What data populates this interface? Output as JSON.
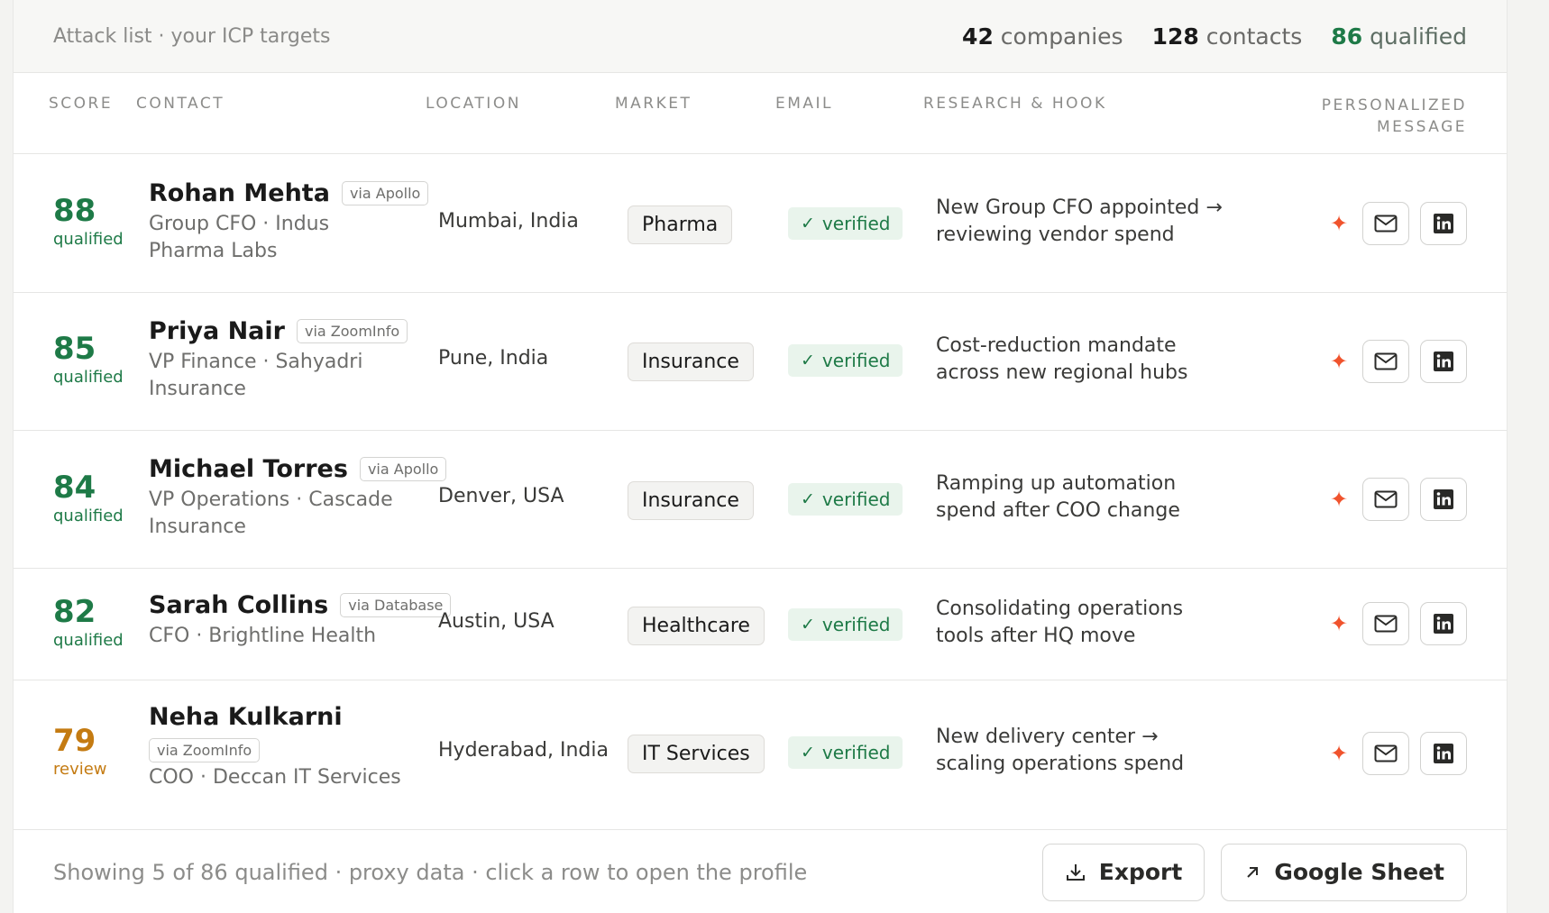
{
  "header": {
    "title": "Attack list · your ICP targets",
    "companies_count": "42",
    "companies_label": "companies",
    "contacts_count": "128",
    "contacts_label": "contacts",
    "qualified_count": "86",
    "qualified_label": "qualified"
  },
  "columns": {
    "score": "SCORE",
    "contact": "CONTACT",
    "location": "LOCATION",
    "market": "MARKET",
    "email": "EMAIL",
    "research": "RESEARCH & HOOK",
    "message_line1": "PERSONALIZED",
    "message_line2": "MESSAGE"
  },
  "rows": [
    {
      "score": "88",
      "status": "qualified",
      "name": "Rohan Mehta",
      "source": "via Apollo",
      "role": "Group CFO · Indus Pharma Labs",
      "location": "Mumbai, India",
      "market": "Pharma",
      "email": "verified",
      "hook": "New Group CFO appointed → reviewing vendor spend"
    },
    {
      "score": "85",
      "status": "qualified",
      "name": "Priya Nair",
      "source": "via ZoomInfo",
      "role": "VP Finance · Sahyadri Insurance",
      "location": "Pune, India",
      "market": "Insurance",
      "email": "verified",
      "hook": "Cost-reduction mandate across new regional hubs"
    },
    {
      "score": "84",
      "status": "qualified",
      "name": "Michael Torres",
      "source": "via Apollo",
      "role": "VP Operations · Cascade Insurance",
      "location": "Denver, USA",
      "market": "Insurance",
      "email": "verified",
      "hook": "Ramping up automation spend after COO change"
    },
    {
      "score": "82",
      "status": "qualified",
      "name": "Sarah Collins",
      "source": "via Database",
      "role": "CFO · Brightline Health",
      "location": "Austin, USA",
      "market": "Healthcare",
      "email": "verified",
      "hook": "Consolidating operations tools after HQ move"
    },
    {
      "score": "79",
      "status": "review",
      "name": "Neha Kulkarni",
      "source": "via ZoomInfo",
      "role": "COO · Deccan IT Services",
      "location": "Hyderabad, India",
      "market": "IT Services",
      "email": "verified",
      "hook": "New delivery center → scaling operations spend"
    }
  ],
  "footer": {
    "note": "Showing 5 of 86 qualified · proxy data · click a row to open the profile",
    "export_label": "Export",
    "sheet_label": "Google Sheet"
  },
  "icons": {
    "email_verified": "check-icon",
    "sparkle": "sparkle-icon",
    "mail": "mail-icon",
    "linkedin": "linkedin-icon",
    "export": "download-icon",
    "sheet": "arrow-up-right-icon"
  },
  "colors": {
    "qualified": "#1e7a47",
    "review": "#c47b12",
    "sparkle": "#f0532d",
    "verified_bg": "#e9f4ec"
  }
}
